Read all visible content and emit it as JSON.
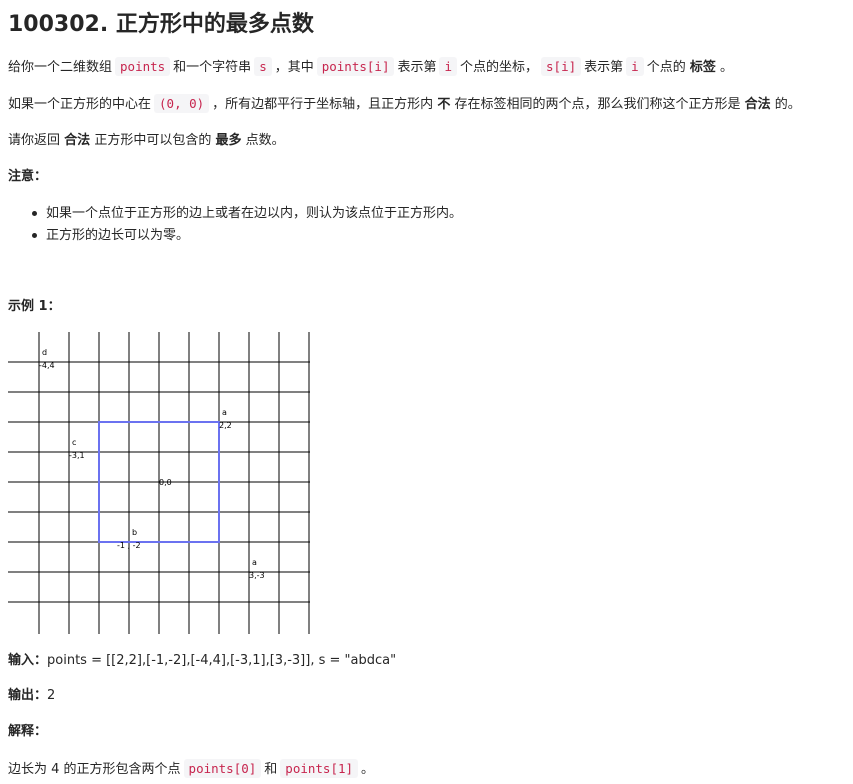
{
  "title": "100302. 正方形中的最多点数",
  "p1": {
    "t1": "给你一个二维数组",
    "c1": "points",
    "t2": "和一个字符串",
    "c2": "s",
    "t3": "，其中",
    "c3": "points[i]",
    "t4": "表示第",
    "c4": "i",
    "t5": "个点的坐标，",
    "c5": "s[i]",
    "t6": "表示第",
    "c6": "i",
    "t7": "个点的",
    "b1": "标签",
    "t8": "。"
  },
  "p2": {
    "t1": "如果一个正方形的中心在",
    "c1": "(0, 0)",
    "t2": "，所有边都平行于坐标轴，且正方形内",
    "b1": "不",
    "t3": "存在标签相同的两个点，那么我们称这个正方形是",
    "b2": "合法",
    "t4": "的。"
  },
  "p3": {
    "t1": "请你返回",
    "b1": "合法",
    "t2": "正方形中可以包含的",
    "b2": "最多",
    "t3": "点数。"
  },
  "note_heading": "注意：",
  "notes": [
    "如果一个点位于正方形的边上或者在边以内，则认为该点位于正方形内。",
    "正方形的边长可以为零。"
  ],
  "example_heading": "示例 1：",
  "figure": {
    "points": [
      {
        "label": "d",
        "coord": "-4,4",
        "x": -4,
        "y": 4
      },
      {
        "label": "c",
        "coord": "-3,1",
        "x": -3,
        "y": 1
      },
      {
        "label": "a",
        "coord": "2,2",
        "x": 2,
        "y": 2
      },
      {
        "label": "b",
        "coord": "-1 , -2",
        "x": -1,
        "y": -2
      },
      {
        "label": "a",
        "coord": "3,-3",
        "x": 3,
        "y": -3
      }
    ],
    "origin_label": "0,0",
    "square_color": "#6b72f0",
    "square_half_side": 2
  },
  "input": {
    "label": "输入：",
    "value": "points = [[2,2],[-1,-2],[-4,4],[-3,1],[3,-3]], s = \"abdca\""
  },
  "output": {
    "label": "输出：",
    "value": "2"
  },
  "explain": {
    "label": "解释："
  },
  "p_last": {
    "t1": "边长为 4 的正方形包含两个点",
    "c1": "points[0]",
    "t2": "和",
    "c2": "points[1]",
    "t3": "。"
  },
  "colors": {
    "code_text": "#c7254e",
    "code_bg": "#f5f5f7",
    "square": "#6b72f0"
  }
}
